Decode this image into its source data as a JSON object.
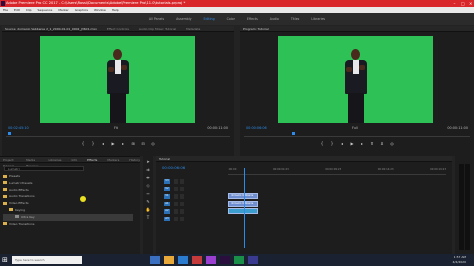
{
  "window": {
    "title": "Adobe Premiere Pro CC 2017 - C:\\Users\\Rossi\\Documents\\Adobe\\Premiere Pro\\11.0\\tutorials.prproj *",
    "controls": [
      "–",
      "□",
      "✕"
    ]
  },
  "menubar": [
    "File",
    "Edit",
    "Clip",
    "Sequence",
    "Marker",
    "Graphics",
    "Window",
    "Help"
  ],
  "workspaces": {
    "tabs": [
      "All Panels",
      "Assembly",
      "Editing",
      "Color",
      "Effects",
      "Audio",
      "Titles",
      "Libraries"
    ],
    "active": "Editing"
  },
  "source": {
    "tabs": [
      "Source: domaolo Vebbenie 2_1_2000-01-01_0002_J3601.mxx",
      "Effect Controls",
      "Audio Clip Mixer: Tutorial",
      "Metadata"
    ],
    "timecode_in": "00:02:45:10",
    "fit": "Fit",
    "timecode_out": "00:00:11:00"
  },
  "program": {
    "tabs": [
      "Program: Tutorial"
    ],
    "timecode_in": "00:00:06:06",
    "fit": "Full",
    "timecode_out": "00:00:11:00"
  },
  "effects": {
    "tabs": [
      "Project: Tutorial",
      "Media Browser",
      "Libraries",
      "Info",
      "Effects",
      "Markers",
      "History"
    ],
    "search": "Lumetri",
    "tree": [
      {
        "label": "Presets",
        "selected": false
      },
      {
        "label": "Lumetri Presets",
        "selected": false
      },
      {
        "label": "Audio Effects",
        "selected": false
      },
      {
        "label": "Audio Transitions",
        "selected": false
      },
      {
        "label": "Video Effects",
        "selected": false
      },
      {
        "label": "Keying",
        "selected": false
      },
      {
        "label": "Ultra Key",
        "selected": true
      },
      {
        "label": "Video Transitions",
        "selected": false
      }
    ]
  },
  "timeline": {
    "title": "Tutorial",
    "timecode": "00:00:06:06",
    "ruler": [
      ":00:00",
      "00:00:04:23",
      "00:00:09:23",
      "00:00:14:23",
      "00:00:19:23"
    ],
    "tracks": [
      "V3",
      "V2",
      "V1",
      "A1",
      "A2",
      "A3"
    ],
    "clips": [
      {
        "label": "domaolo Vebbenie",
        "kind": "video"
      },
      {
        "label": "domaolo Vebbenie",
        "kind": "video"
      },
      {
        "label": "",
        "kind": "audio"
      }
    ]
  },
  "taskbar": {
    "search_placeholder": "Type here to search",
    "time": "1:57 AM",
    "date": "4/4/2020"
  },
  "colors": {
    "accent": "#2d8ceb",
    "title_bar": "#d9262b",
    "green_screen": "#2ec256"
  }
}
